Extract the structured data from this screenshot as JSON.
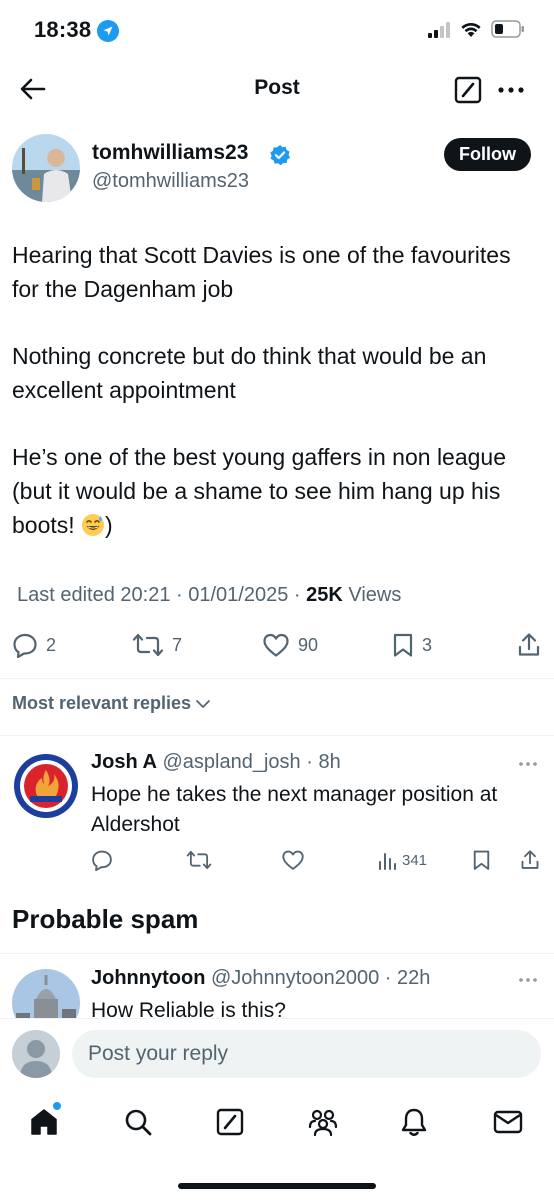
{
  "status_bar": {
    "time": "18:38",
    "icons": [
      "location-arrow-icon",
      "cellular-signal-icon",
      "wifi-icon",
      "battery-icon"
    ]
  },
  "header": {
    "title": "Post",
    "icons": [
      "back-arrow-icon",
      "compose-icon",
      "more-options-icon"
    ]
  },
  "post": {
    "author_name": "tomhwilliams23",
    "author_handle": "@tomhwilliams23",
    "verified": true,
    "follow_label": "Follow",
    "paragraphs": [
      "Hearing that Scott Davies is one of the favourites for the Dagenham job",
      "Nothing concrete but do think that would be an excellent appointment",
      "He’s one of the best young gaffers in non league (but it would be a shame to see him hang up his boots! "
    ],
    "paragraph3_end": ")",
    "emoji": "sweat-smile-emoji",
    "edited_label": "Last edited 20:21 · 01/01/2025",
    "views_sep": " · ",
    "views_count": "25K",
    "views_label": " Views",
    "stats": {
      "replies": "2",
      "reposts": "7",
      "likes": "90",
      "bookmarks": "3"
    }
  },
  "replies_sort": {
    "label": "Most relevant replies"
  },
  "replies": [
    {
      "name": "Josh A",
      "handle": "@aspland_josh",
      "time": "8h",
      "text": "Hope he takes the next manager position at Aldershot",
      "views": "341"
    }
  ],
  "spam_section": {
    "heading": "Probable spam",
    "replies": [
      {
        "name": "Johnnytoon",
        "handle": "@Johnnytoon2000",
        "time": "22h",
        "text": "How Reliable is this?"
      }
    ]
  },
  "composer": {
    "placeholder": "Post your reply"
  },
  "bottom_nav": {
    "items": [
      "home-icon",
      "search-icon",
      "grok-icon",
      "communities-icon",
      "notifications-icon",
      "messages-icon"
    ]
  },
  "colors": {
    "text": "#0f1419",
    "secondary": "#536471",
    "accent": "#1d9bf0",
    "divider": "#eff3f4"
  }
}
